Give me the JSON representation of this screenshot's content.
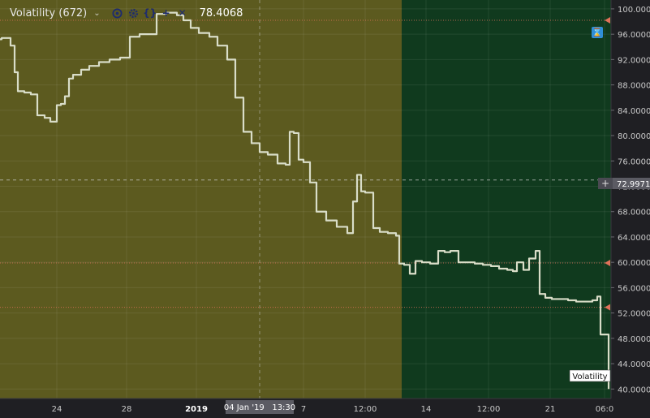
{
  "legend": {
    "name": "Volatility (672)",
    "chevron": "chevron-down-icon",
    "icons": [
      "eye-icon",
      "gear-icon",
      "source-code-icon",
      "plus-icon",
      "close-icon"
    ],
    "value": "78.4068"
  },
  "crosshair": {
    "price_label": "72.9971",
    "time_label": "04 Jan '19   13:30"
  },
  "series_tag": "Volatility",
  "colors": {
    "zone_one": "#5c5a1f",
    "zone_two": "#103a1e",
    "line": "#d9ddc8",
    "axis_bg": "#1f1f23",
    "axis_text": "#c9c9c9",
    "marker": "#e0715a",
    "badge": "#2f8fd8"
  },
  "chart_data": {
    "type": "line",
    "series": [
      {
        "x": [
          0,
          2,
          6,
          13,
          18,
          22,
          30,
          38,
          46,
          55,
          62,
          70,
          75,
          80,
          85,
          90,
          100,
          110,
          122,
          135,
          148,
          160,
          172,
          182,
          193,
          205,
          218,
          226,
          235,
          245,
          258,
          268,
          280,
          290,
          300,
          310,
          320,
          330,
          342,
          352,
          357,
          362,
          368,
          374,
          382,
          390,
          402,
          415,
          428,
          435,
          440,
          445,
          450,
          460,
          468,
          478,
          488,
          492,
          498,
          505,
          512,
          520,
          530,
          540,
          548,
          555,
          565,
          575,
          585,
          595,
          605,
          615,
          625,
          632,
          637,
          645,
          652,
          660,
          665,
          672,
          680,
          690,
          700,
          710,
          720,
          730,
          736,
          740,
          745,
          750
        ],
        "y": [
          95.2,
          95.4,
          95.4,
          94.2,
          90.0,
          87.0,
          86.8,
          86.5,
          83.2,
          82.8,
          82.2,
          84.8,
          85.0,
          86.2,
          89.0,
          89.6,
          90.4,
          91.0,
          91.6,
          92.0,
          92.3,
          95.6,
          96.0,
          96.0,
          99.2,
          99.4,
          99.0,
          98.2,
          97.0,
          96.2,
          95.6,
          94.2,
          92.0,
          86.0,
          80.6,
          78.8,
          77.4,
          77.0,
          75.6,
          75.4,
          80.6,
          80.4,
          76.2,
          75.8,
          72.6,
          68.0,
          66.6,
          65.6,
          64.6,
          69.6,
          73.8,
          71.2,
          71.0,
          65.4,
          64.8,
          64.6,
          64.2,
          59.8,
          59.6,
          58.2,
          60.2,
          60.0,
          59.8,
          61.8,
          61.6,
          61.8,
          60.0,
          60.0,
          59.8,
          59.6,
          59.4,
          59.0,
          58.8,
          58.6,
          60.0,
          58.8,
          60.6,
          61.8,
          55.0,
          54.4,
          54.2,
          54.2,
          54.0,
          53.8,
          53.8,
          54.0,
          54.6,
          48.6,
          48.6,
          40.0
        ],
        "name": "Volatility"
      }
    ],
    "y_ticks": [
      "100.0000",
      "96.0000",
      "92.0000",
      "88.0000",
      "84.0000",
      "80.0000",
      "76.0000",
      "72.0000",
      "68.0000",
      "64.0000",
      "60.0000",
      "56.0000",
      "52.0000",
      "48.0000",
      "44.0000",
      "40.0000"
    ],
    "y_tick_values": [
      100,
      96,
      92,
      88,
      84,
      80,
      76,
      72,
      68,
      64,
      60,
      56,
      52,
      48,
      44,
      40
    ],
    "x_ticks": [
      {
        "label": "24",
        "x": 70
      },
      {
        "label": "28",
        "x": 156
      },
      {
        "label": "2019",
        "x": 242
      },
      {
        "label": "7",
        "x": 374
      },
      {
        "label": "12:00",
        "x": 450
      },
      {
        "label": "14",
        "x": 525
      },
      {
        "label": "12:00",
        "x": 602
      },
      {
        "label": "21",
        "x": 678
      },
      {
        "label": "06:0",
        "x": 745
      }
    ],
    "ylim": [
      38.5,
      101.4
    ],
    "zones": [
      {
        "from": 0,
        "to": 495,
        "color": "zone_one"
      },
      {
        "from": 495,
        "to": 753,
        "color": "zone_two"
      }
    ],
    "crosshair": {
      "x": 320,
      "y": 72.9971
    },
    "h_lines": [
      {
        "y": 98.2,
        "marker": true
      },
      {
        "y": 59.9,
        "marker": true
      },
      {
        "y": 52.9,
        "marker": true
      }
    ],
    "grid": true
  }
}
